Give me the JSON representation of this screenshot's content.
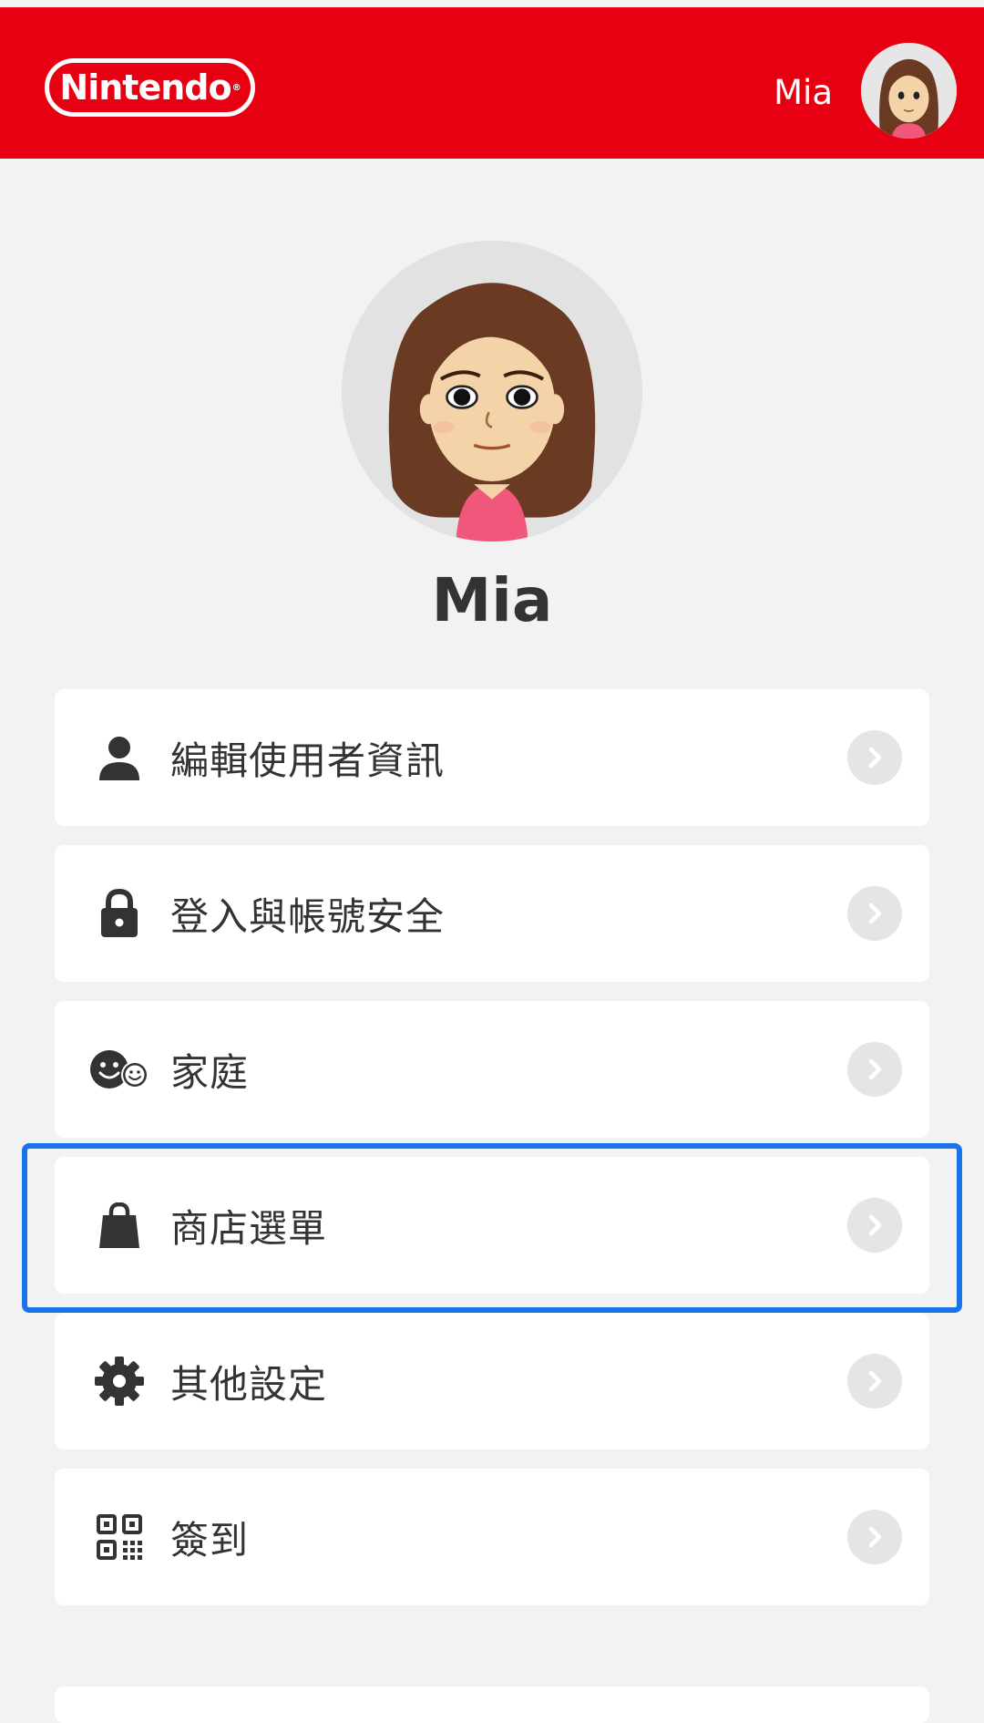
{
  "header": {
    "brand": "Nintendo",
    "username": "Mia"
  },
  "profile": {
    "name": "Mia"
  },
  "menu": [
    {
      "label": "編輯使用者資訊",
      "icon": "person-icon"
    },
    {
      "label": "登入與帳號安全",
      "icon": "lock-icon"
    },
    {
      "label": "家庭",
      "icon": "family-icon"
    },
    {
      "label": "商店選單",
      "icon": "shopping-bag-icon"
    },
    {
      "label": "其他設定",
      "icon": "gear-icon"
    },
    {
      "label": "簽到",
      "icon": "qr-code-icon"
    }
  ],
  "colors": {
    "brand_red": "#e60012",
    "highlight_blue": "#1a73e8"
  }
}
